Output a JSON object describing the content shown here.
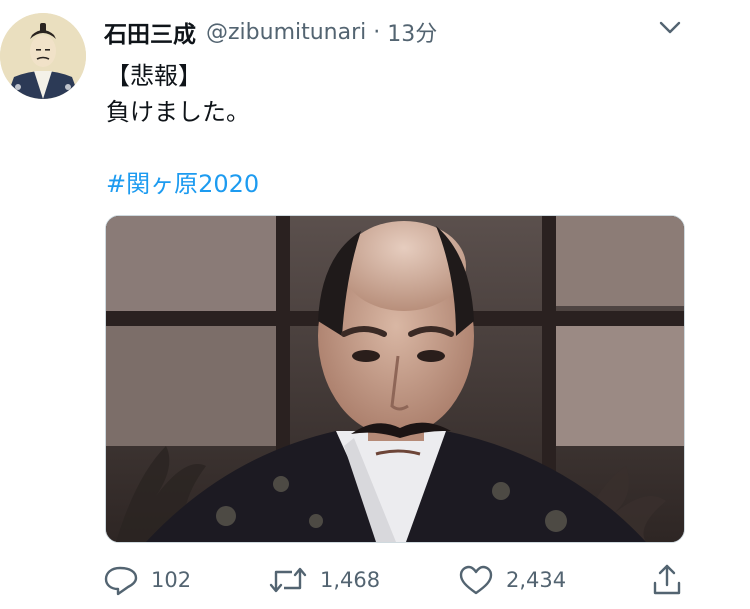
{
  "author": {
    "display_name": "石田三成",
    "handle": "@zibumitunari",
    "separator": "·",
    "time": "13分",
    "avatar_icon": "samurai-portrait-avatar"
  },
  "tweet": {
    "lines": [
      "【悲報】",
      "負けました。"
    ],
    "hashtag": "#関ヶ原2020",
    "media_description": "samurai-photo"
  },
  "actions": {
    "reply_count": "102",
    "retweet_count": "1,468",
    "like_count": "2,434"
  },
  "colors": {
    "link": "#1d9bf0",
    "secondary_text": "#536471",
    "primary_text": "#0f1419"
  }
}
